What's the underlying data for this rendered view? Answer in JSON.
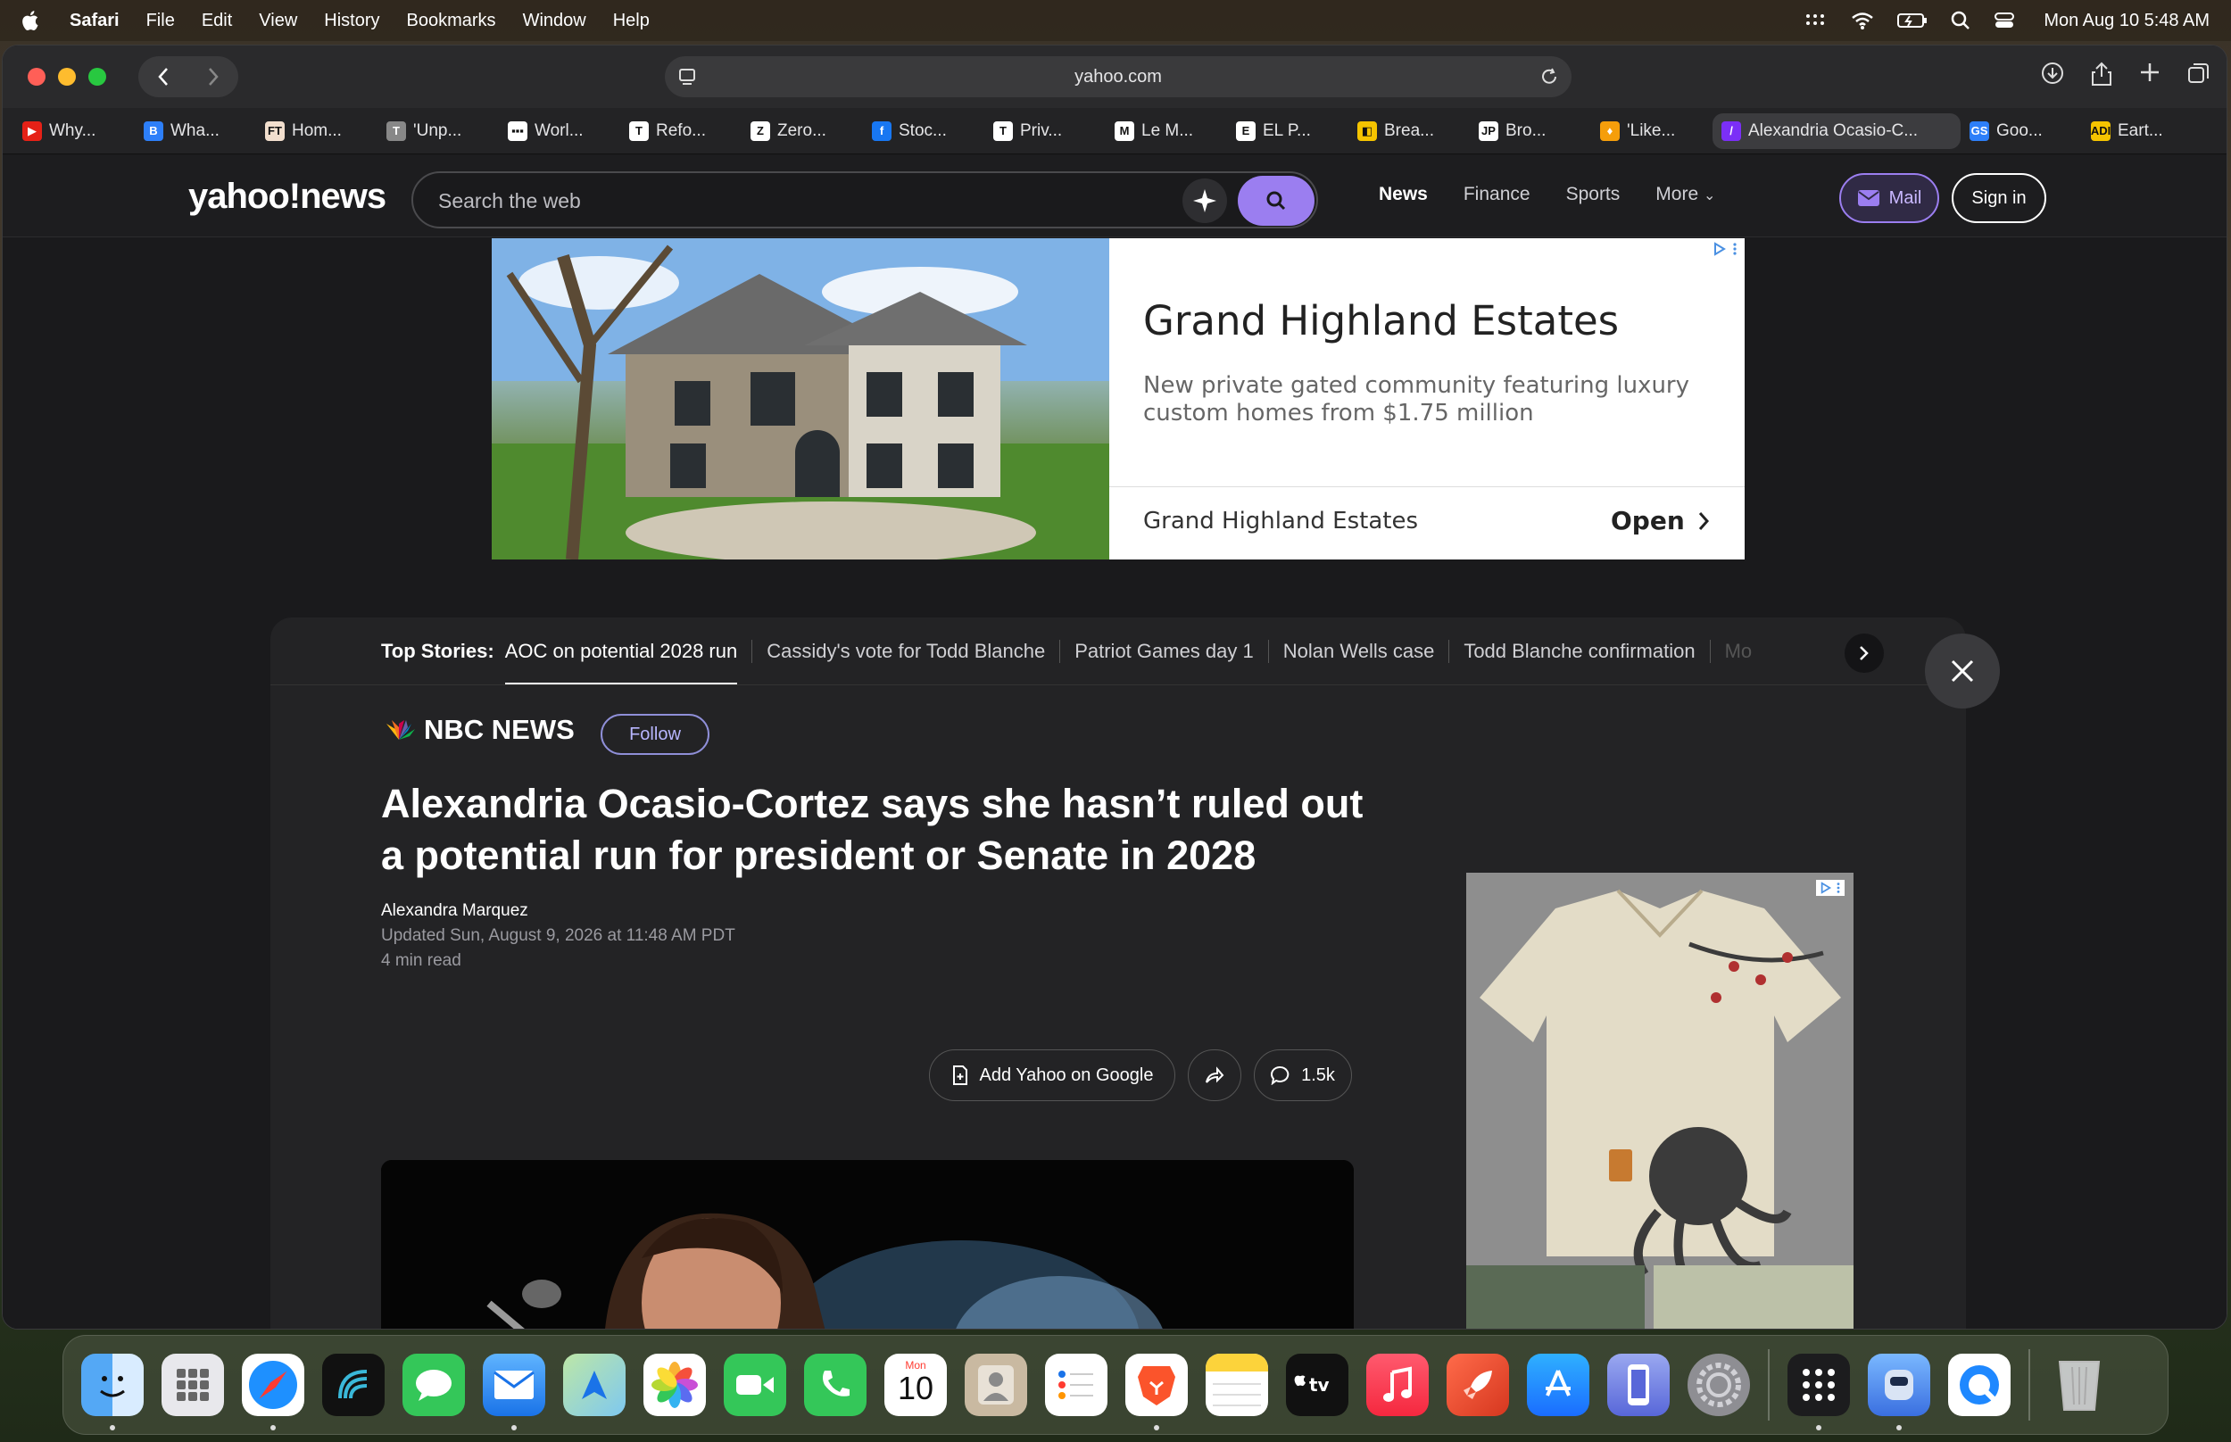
{
  "menubar": {
    "app_name": "Safari",
    "menus": [
      "File",
      "Edit",
      "View",
      "History",
      "Bookmarks",
      "Window",
      "Help"
    ],
    "clock": "Mon Aug 10  5:48 AM"
  },
  "browser": {
    "url": "yahoo.com",
    "tabs": [
      {
        "label": "Why...",
        "fav_color": "#e62117",
        "fav_text": "▶"
      },
      {
        "label": "Wha...",
        "fav_color": "#2d7ff9",
        "fav_text": "B"
      },
      {
        "label": "Hom...",
        "fav_color": "#f2dfce",
        "fav_text": "FT"
      },
      {
        "label": "'Unp...",
        "fav_color": "#888888",
        "fav_text": "T"
      },
      {
        "label": "Worl...",
        "fav_color": "#ffffff",
        "fav_text": "▪▪▪"
      },
      {
        "label": "Refo...",
        "fav_color": "#ffffff",
        "fav_text": "T"
      },
      {
        "label": "Zero...",
        "fav_color": "#ffffff",
        "fav_text": "Z"
      },
      {
        "label": "Stoc...",
        "fav_color": "#1877f2",
        "fav_text": "f"
      },
      {
        "label": "Priv...",
        "fav_color": "#ffffff",
        "fav_text": "T"
      },
      {
        "label": "Le M...",
        "fav_color": "#ffffff",
        "fav_text": "M"
      },
      {
        "label": "EL P...",
        "fav_color": "#ffffff",
        "fav_text": "E"
      },
      {
        "label": "Brea...",
        "fav_color": "#f5c400",
        "fav_text": "◧"
      },
      {
        "label": "Bro...",
        "fav_color": "#ffffff",
        "fav_text": "JP"
      },
      {
        "label": "'Like...",
        "fav_color": "#f59e0b",
        "fav_text": "♦"
      },
      {
        "label": "Alexandria Ocasio-C...",
        "fav_color": "#7b2ff7",
        "fav_text": "/",
        "active": true
      },
      {
        "label": "Goo...",
        "fav_color": "#2d7ff9",
        "fav_text": "GS"
      },
      {
        "label": "Eart...",
        "fav_color": "#f5c400",
        "fav_text": "ADI"
      }
    ]
  },
  "yahoo": {
    "logo": "yahoo!news",
    "search_placeholder": "Search the web",
    "nav": {
      "news": "News",
      "finance": "Finance",
      "sports": "Sports",
      "more": "More"
    },
    "mail": "Mail",
    "signin": "Sign in"
  },
  "banner_ad": {
    "title": "Grand Highland Estates",
    "description": "New private gated community featuring luxury custom homes from $1.75 million",
    "brand": "Grand Highland Estates",
    "cta": "Open"
  },
  "top_stories": {
    "label": "Top Stories:",
    "items": [
      "AOC on potential 2028 run",
      "Cassidy's vote for Todd Blanche",
      "Patriot Games day 1",
      "Nolan Wells case",
      "Todd Blanche confirmation",
      "Mo"
    ]
  },
  "article": {
    "source": "NBC NEWS",
    "follow": "Follow",
    "headline": "Alexandria Ocasio-Cortez says she hasn’t ruled out a potential run for president or Senate in 2028",
    "author": "Alexandra Marquez",
    "updated": "Updated Sun, August 9, 2026 at 11:48 AM PDT",
    "read_time": "4 min read",
    "add_google": "Add Yahoo on Google",
    "comments": "1.5k"
  },
  "dock": {
    "calendar_month": "Mon",
    "calendar_day": "10",
    "apps": [
      "Finder",
      "Launchpad",
      "Safari",
      "Podcasts-like",
      "Messages",
      "Mail",
      "Maps",
      "Photos",
      "FaceTime",
      "Phone",
      "Calendar",
      "Contacts",
      "Reminders",
      "Brave",
      "Notes",
      "Apple TV",
      "Music",
      "Rocket",
      "App Store",
      "Simulator",
      "System Settings",
      "Apps",
      "Migration",
      "QuickTime",
      "Trash"
    ]
  },
  "colors": {
    "accent_purple": "#9b7ef0",
    "page_bg": "#1a1a1c"
  }
}
